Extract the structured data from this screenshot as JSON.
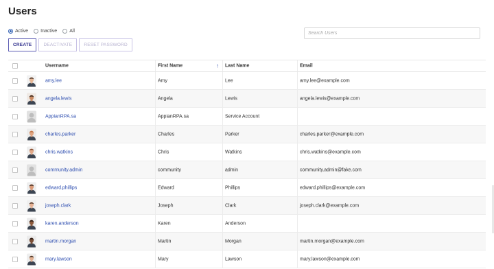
{
  "page": {
    "title": "Users"
  },
  "filters": {
    "options": [
      {
        "label": "Active",
        "checked": true
      },
      {
        "label": "Inactive",
        "checked": false
      },
      {
        "label": "All",
        "checked": false
      }
    ]
  },
  "search": {
    "placeholder": "Search Users"
  },
  "toolbar": {
    "create_label": "CREATE",
    "deactivate_label": "DEACTIVATE",
    "reset_password_label": "RESET PASSWORD"
  },
  "table": {
    "columns": {
      "username": "Username",
      "first_name": "First Name",
      "last_name": "Last Name",
      "email": "Email"
    },
    "sort_indicator": "↑",
    "rows": [
      {
        "username": "amy.lee",
        "first_name": "Amy",
        "last_name": "Lee",
        "email": "amy.lee@example.com",
        "avatar": "female-photo",
        "skin": "#e7b796",
        "hair": "#3a2a20",
        "bg": "#f2f2f2"
      },
      {
        "username": "angela.lewis",
        "first_name": "Angela",
        "last_name": "Lewis",
        "email": "angela.lewis@example.com",
        "avatar": "female-photo",
        "skin": "#c98a62",
        "hair": "#1f1410",
        "bg": "#efe9e4"
      },
      {
        "username": "AppianRPA.sa",
        "first_name": "AppianRPA.sa",
        "last_name": "Service Account",
        "email": "",
        "avatar": "default-silhouette",
        "skin": "#c9c9c9",
        "hair": "#c9c9c9",
        "bg": "#e2e2e2"
      },
      {
        "username": "charles.parker",
        "first_name": "Charles",
        "last_name": "Parker",
        "email": "charles.parker@example.com",
        "avatar": "male-photo",
        "skin": "#e0a683",
        "hair": "#b86b3d",
        "bg": "#ececec"
      },
      {
        "username": "chris.watkins",
        "first_name": "Chris",
        "last_name": "Watkins",
        "email": "chris.watkins@example.com",
        "avatar": "male-photo",
        "skin": "#e3aa8a",
        "hair": "#6e3a22",
        "bg": "#efefef"
      },
      {
        "username": "community.admin",
        "first_name": "community",
        "last_name": "admin",
        "email": "community.admin@fake.com",
        "avatar": "default-silhouette",
        "skin": "#c9c9c9",
        "hair": "#c9c9c9",
        "bg": "#e2e2e2"
      },
      {
        "username": "edward.phillips",
        "first_name": "Edward",
        "last_name": "Phillips",
        "email": "edward.phillips@example.com",
        "avatar": "male-photo",
        "skin": "#d99a78",
        "hair": "#2b1d16",
        "bg": "#eeeeee"
      },
      {
        "username": "joseph.clark",
        "first_name": "Joseph",
        "last_name": "Clark",
        "email": "joseph.clark@example.com",
        "avatar": "male-photo",
        "skin": "#e7b294",
        "hair": "#3b2a20",
        "bg": "#f0f0f0"
      },
      {
        "username": "karen.anderson",
        "first_name": "Karen",
        "last_name": "Anderson",
        "email": "",
        "avatar": "male-photo",
        "skin": "#8d5a3c",
        "hair": "#1a120d",
        "bg": "#ececec"
      },
      {
        "username": "martin.morgan",
        "first_name": "Martin",
        "last_name": "Morgan",
        "email": "martin.morgan@example.com",
        "avatar": "male-photo",
        "skin": "#7b4e36",
        "hair": "#1a120d",
        "bg": "#ebebeb"
      },
      {
        "username": "mary.lawson",
        "first_name": "Mary",
        "last_name": "Lawson",
        "email": "mary.lawson@example.com",
        "avatar": "male-photo",
        "skin": "#e2b192",
        "hair": "#2a1e18",
        "bg": "#eeeeee"
      }
    ]
  },
  "colors": {
    "link": "#2f4fb0",
    "primary_button_border": "#5b5bb3",
    "radio_accent": "#2f5fb3"
  }
}
